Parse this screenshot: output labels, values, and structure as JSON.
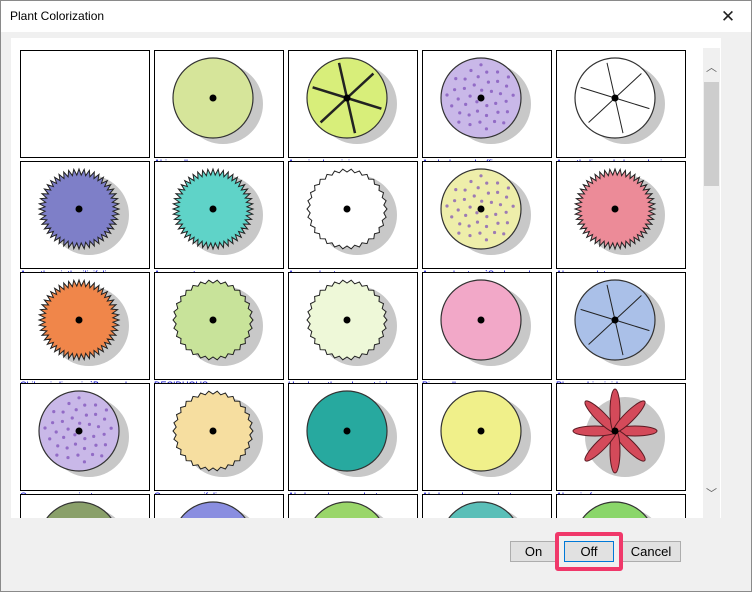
{
  "window": {
    "title": "Plant Colorization",
    "close_glyph": "✕"
  },
  "buttons": {
    "on": "On",
    "off": "Off",
    "cancel": "Cancel"
  },
  "scrollbar": {
    "up_glyph": "︿",
    "down_glyph": "﹀"
  },
  "plants": [
    {
      "label": "",
      "color": "#ffffff",
      "pattern": "blank"
    },
    {
      "label": "Abies alba",
      "color": "#d6e59a",
      "pattern": "blob"
    },
    {
      "label": "Acacia abyssinica",
      "color": "#d8ee7a",
      "pattern": "star"
    },
    {
      "label": "Acalypha godseffiana",
      "color": "#c9b8e8",
      "pattern": "speckle"
    },
    {
      "label": "Acantholimon hohenackeri",
      "color": "#ffffff",
      "pattern": "lines"
    },
    {
      "label": "Acanthomintha ilicifolia",
      "color": "#7e7fc8",
      "pattern": "spiky"
    },
    {
      "label": "Acer argutum",
      "color": "#5fd3c8",
      "pattern": "spiky"
    },
    {
      "label": "Acer palmatum",
      "color": "#ffffff",
      "pattern": "wavy"
    },
    {
      "label": "Acer palmatum `Scolopendr",
      "color": "#eeeeaa",
      "pattern": "speckle"
    },
    {
      "label": "Alnus cordata",
      "color": "#ec8b98",
      "pattern": "spiky"
    },
    {
      "label": "Chilopsis linearis `Burgundy",
      "color": "#f0864a",
      "pattern": "spiky"
    },
    {
      "label": "DECIDUOUS",
      "color": "#c8e39a",
      "pattern": "wavy"
    },
    {
      "label": "Handroanthus chrysotrichus",
      "color": "#eef8d8",
      "pattern": "wavy"
    },
    {
      "label": "Pinus alba",
      "color": "#f2a8c8",
      "pattern": "blob"
    },
    {
      "label": "Pleuraphis rigida",
      "color": "#aac0e8",
      "pattern": "lines"
    },
    {
      "label": "Quercus acuminata",
      "color": "#c9b8e8",
      "pattern": "speckle"
    },
    {
      "label": "Quercus agrifolia",
      "color": "#f6dea0",
      "pattern": "wavy"
    },
    {
      "label": "Abelmoschus esculentus",
      "color": "#27a99f",
      "pattern": "blob"
    },
    {
      "label": "Abelmoschus esculentus",
      "color": "#f0f08a",
      "pattern": "blob"
    },
    {
      "label": "Abronia fragrans",
      "color": "#d44a5a",
      "pattern": "flower"
    },
    {
      "label": "",
      "color": "#8aa06a",
      "pattern": "blob"
    },
    {
      "label": "",
      "color": "#8a8ee0",
      "pattern": "blob"
    },
    {
      "label": "",
      "color": "#9ad66a",
      "pattern": "blob"
    },
    {
      "label": "",
      "color": "#5abfb8",
      "pattern": "blob"
    },
    {
      "label": "",
      "color": "#8ad66a",
      "pattern": "blob"
    }
  ]
}
